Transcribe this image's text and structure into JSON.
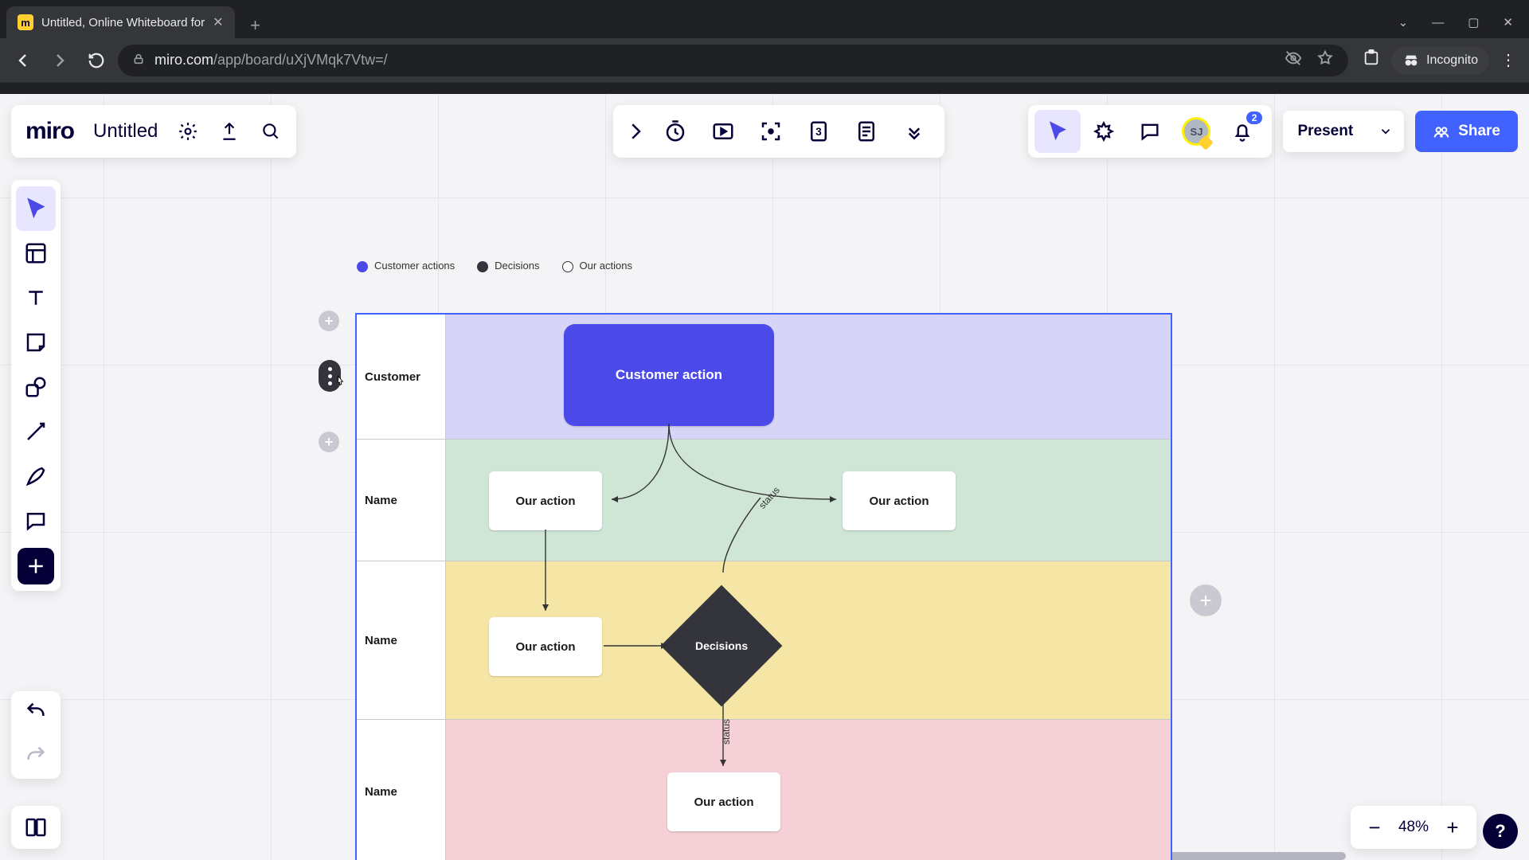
{
  "browser": {
    "tab_title": "Untitled, Online Whiteboard for",
    "url_host": "miro.com",
    "url_path": "/app/board/uXjVMqk7Vtw=/",
    "incognito_label": "Incognito"
  },
  "header": {
    "logo": "miro",
    "board_title": "Untitled",
    "present_label": "Present",
    "share_label": "Share",
    "avatar_initials": "SJ",
    "notif_count": "2"
  },
  "zoom": {
    "level": "48%"
  },
  "legend": {
    "items": [
      {
        "label": "Customer actions",
        "color": "#4b49e8",
        "fill": true
      },
      {
        "label": "Decisions",
        "color": "#34343c",
        "fill": true
      },
      {
        "label": "Our actions",
        "color": "#34343c",
        "fill": false
      }
    ]
  },
  "lanes": [
    {
      "label": "Customer"
    },
    {
      "label": "Name"
    },
    {
      "label": "Name"
    },
    {
      "label": "Name"
    }
  ],
  "nodes": {
    "customer_action": "Customer action",
    "our_action_a": "Our action",
    "our_action_b": "Our action",
    "our_action_c": "Our action",
    "our_action_d": "Our action",
    "decisions": "Decisions"
  },
  "edge_labels": {
    "status1": "status",
    "status2": "status"
  }
}
